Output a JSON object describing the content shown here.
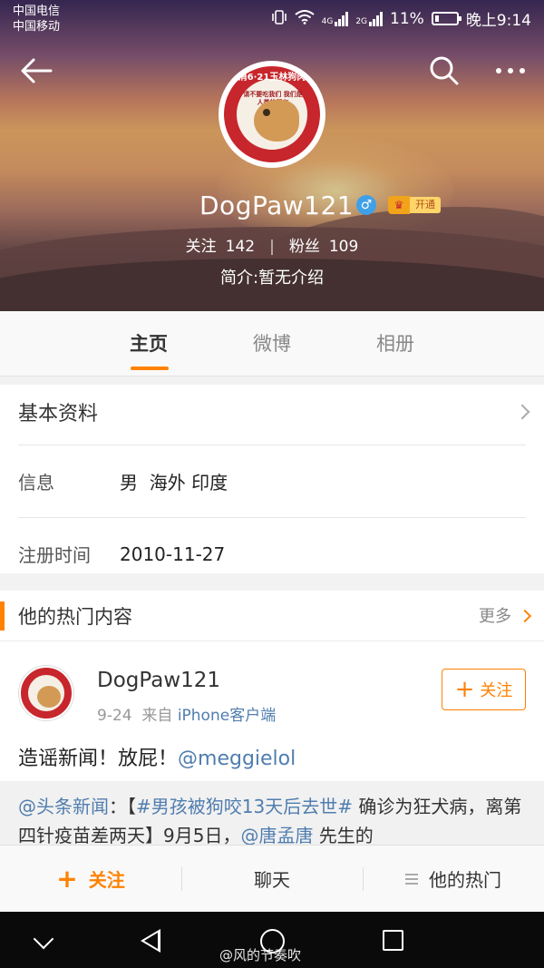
{
  "status_bar": {
    "carrier_1": "中国电信",
    "carrier_2": "中国移动",
    "signal_4g": "4G",
    "signal_2g": "2G",
    "battery": "11%",
    "time": "晚上9:14"
  },
  "profile": {
    "username": "DogPaw121",
    "gender": "♂",
    "vip_label": "开通",
    "following_label": "关注",
    "following_count": "142",
    "divider": "|",
    "followers_label": "粉丝",
    "followers_count": "109",
    "bio": "简介:暂无介绍",
    "avatar_ring_text": "取消6·21玉林狗肉节",
    "avatar_center_text": "请不要吃我们\n我们是人类的朋友"
  },
  "tabs": [
    {
      "label": "主页",
      "active": true
    },
    {
      "label": "微博",
      "active": false
    },
    {
      "label": "相册",
      "active": false
    }
  ],
  "basic_info": {
    "title": "基本资料",
    "rows": [
      {
        "key": "信息",
        "value": "男  海外 印度"
      },
      {
        "key": "注册时间",
        "value": "2010-11-27"
      }
    ]
  },
  "hot": {
    "title": "他的热门内容",
    "more": "更多",
    "post": {
      "author": "DogPaw121",
      "date": "9-24",
      "from_label": "来自",
      "source": "iPhone客户端",
      "follow_label": "关注",
      "text": "造谣新闻！放屁！",
      "mention": "@meggielol"
    },
    "repost": {
      "mention": "@头条新闻",
      "colon": "：【",
      "hashtag": "#男孩被狗咬13天后去世#",
      "text1": " 确诊为狂犬病，离第四针疫苗差两天】9月5日，",
      "mention2": "@唐孟唐",
      "text2": " 先生的"
    }
  },
  "actionbar": {
    "follow": "关注",
    "chat": "聊天",
    "hot": "他的热门"
  },
  "watermark": "@风的节奏吹",
  "colors": {
    "accent": "#ff8200",
    "link": "#507daf",
    "badge_red": "#c7262c"
  }
}
